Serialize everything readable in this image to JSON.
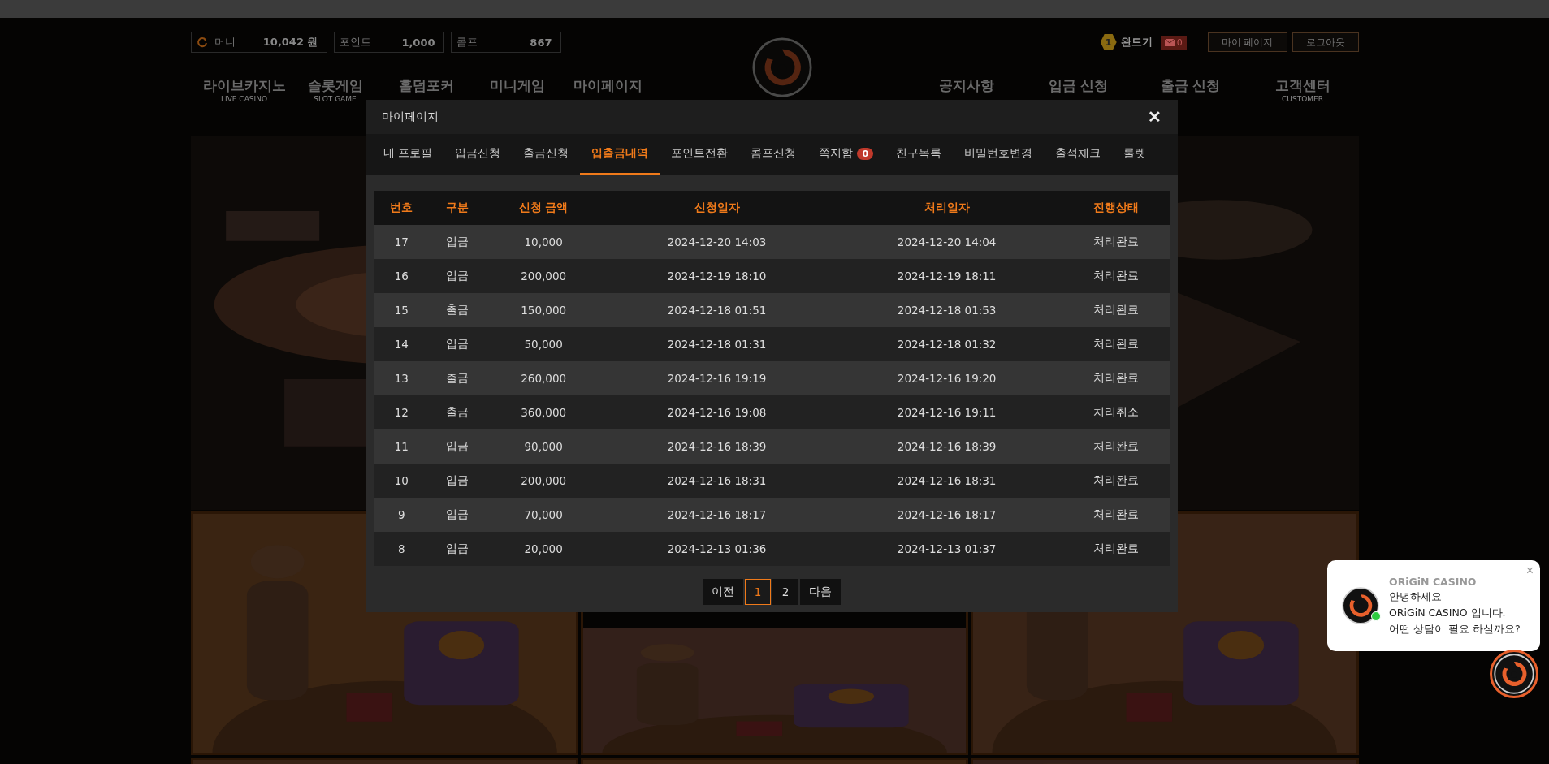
{
  "header": {
    "wallet": [
      {
        "label": "머니",
        "value": "10,042 원",
        "icon": true
      },
      {
        "label": "포인트",
        "value": "1,000",
        "icon": false
      },
      {
        "label": "콤프",
        "value": "867",
        "icon": false
      }
    ],
    "user": {
      "level": "1",
      "name": "완드기"
    },
    "mail_count": "0",
    "buttons": [
      "마이 페이지",
      "로그아웃"
    ]
  },
  "nav": {
    "left": [
      {
        "label": "라이브카지노",
        "sub": "LIVE CASINO"
      },
      {
        "label": "슬롯게임",
        "sub": "SLOT GAME"
      },
      {
        "label": "홀덤포커"
      },
      {
        "label": "미니게임"
      },
      {
        "label": "마이페이지"
      }
    ],
    "right": [
      {
        "label": "공지사항"
      },
      {
        "label": "입금 신청"
      },
      {
        "label": "출금 신청"
      },
      {
        "label": "고객센터",
        "sub": "CUSTOMER"
      }
    ]
  },
  "modal": {
    "title": "마이페이지",
    "close": "✕",
    "tabs": [
      {
        "label": "내 프로필",
        "selected": false
      },
      {
        "label": "입금신청",
        "selected": false
      },
      {
        "label": "출금신청",
        "selected": false
      },
      {
        "label": "입출금내역",
        "selected": true
      },
      {
        "label": "포인트전환",
        "selected": false
      },
      {
        "label": "콤프신청",
        "selected": false
      },
      {
        "label": "쪽지함",
        "selected": false,
        "badge": "0"
      },
      {
        "label": "친구목록",
        "selected": false
      },
      {
        "label": "비밀번호변경",
        "selected": false
      },
      {
        "label": "출석체크",
        "selected": false
      },
      {
        "label": "룰렛",
        "selected": false
      }
    ],
    "table": {
      "columns": [
        "번호",
        "구분",
        "신청 금액",
        "신청일자",
        "처리일자",
        "진행상태"
      ],
      "rows": [
        [
          "17",
          "입금",
          "10,000",
          "2024-12-20 14:03",
          "2024-12-20 14:04",
          "처리완료"
        ],
        [
          "16",
          "입금",
          "200,000",
          "2024-12-19 18:10",
          "2024-12-19 18:11",
          "처리완료"
        ],
        [
          "15",
          "출금",
          "150,000",
          "2024-12-18 01:51",
          "2024-12-18 01:53",
          "처리완료"
        ],
        [
          "14",
          "입금",
          "50,000",
          "2024-12-18 01:31",
          "2024-12-18 01:32",
          "처리완료"
        ],
        [
          "13",
          "출금",
          "260,000",
          "2024-12-16 19:19",
          "2024-12-16 19:20",
          "처리완료"
        ],
        [
          "12",
          "출금",
          "360,000",
          "2024-12-16 19:08",
          "2024-12-16 19:11",
          "처리취소"
        ],
        [
          "11",
          "입금",
          "90,000",
          "2024-12-16 18:39",
          "2024-12-16 18:39",
          "처리완료"
        ],
        [
          "10",
          "입금",
          "200,000",
          "2024-12-16 18:31",
          "2024-12-16 18:31",
          "처리완료"
        ],
        [
          "9",
          "입금",
          "70,000",
          "2024-12-16 18:17",
          "2024-12-16 18:17",
          "처리완료"
        ],
        [
          "8",
          "입금",
          "20,000",
          "2024-12-13 01:36",
          "2024-12-13 01:37",
          "처리완료"
        ]
      ]
    },
    "pagination": {
      "prev": "이전",
      "pages": [
        {
          "label": "1",
          "selected": true
        },
        {
          "label": "2",
          "selected": false
        }
      ],
      "next": "다음"
    }
  },
  "chat": {
    "brand": "ORiGiN CASINO",
    "lines": [
      "안녕하세요",
      "ORiGiN CASINO 입니다.",
      "어떤 상담이 필요 하실까요?"
    ],
    "online": true,
    "close": "×"
  }
}
